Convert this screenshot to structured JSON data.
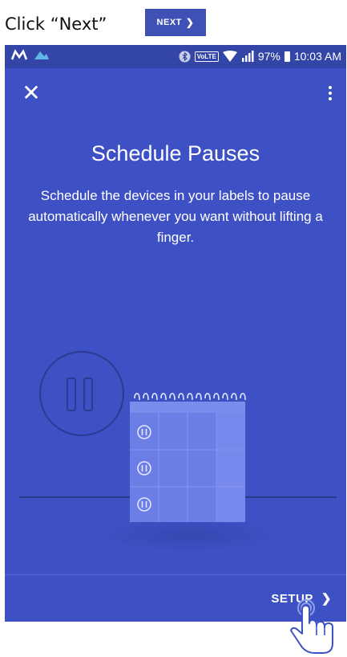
{
  "instruction": {
    "text": "Click “Next”",
    "button_label": "NEXT"
  },
  "status_bar": {
    "volte": "VoLTE",
    "battery": "97%",
    "time": "10:03 AM"
  },
  "screen": {
    "title": "Schedule Pauses",
    "description": "Schedule the devices in your labels to pause automatically whenever you want without lifting a finger.",
    "setup_label": "SETUP"
  },
  "colors": {
    "background": "#3e51c4",
    "status_bar": "#3445a8",
    "calendar": "#6a7ee6"
  },
  "icons": [
    "close-icon",
    "more-vert-icon",
    "pause-icon",
    "calendar-icon",
    "chevron-right-icon",
    "hand-pointer-icon"
  ]
}
